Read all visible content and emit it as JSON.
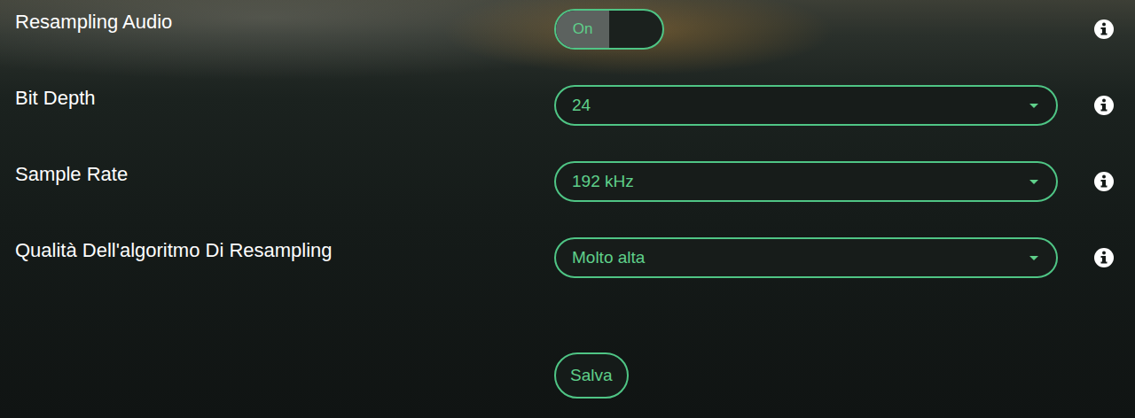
{
  "settings": [
    {
      "kind": "toggle",
      "label": "Resampling Audio",
      "value": "On",
      "on": true
    },
    {
      "kind": "select",
      "label": "Bit Depth",
      "value": "24"
    },
    {
      "kind": "select",
      "label": "Sample Rate",
      "value": "192 kHz"
    },
    {
      "kind": "select",
      "label": "Qualità Dell'algoritmo Di Resampling",
      "value": "Molto alta"
    }
  ],
  "buttons": [
    "Salva"
  ]
}
